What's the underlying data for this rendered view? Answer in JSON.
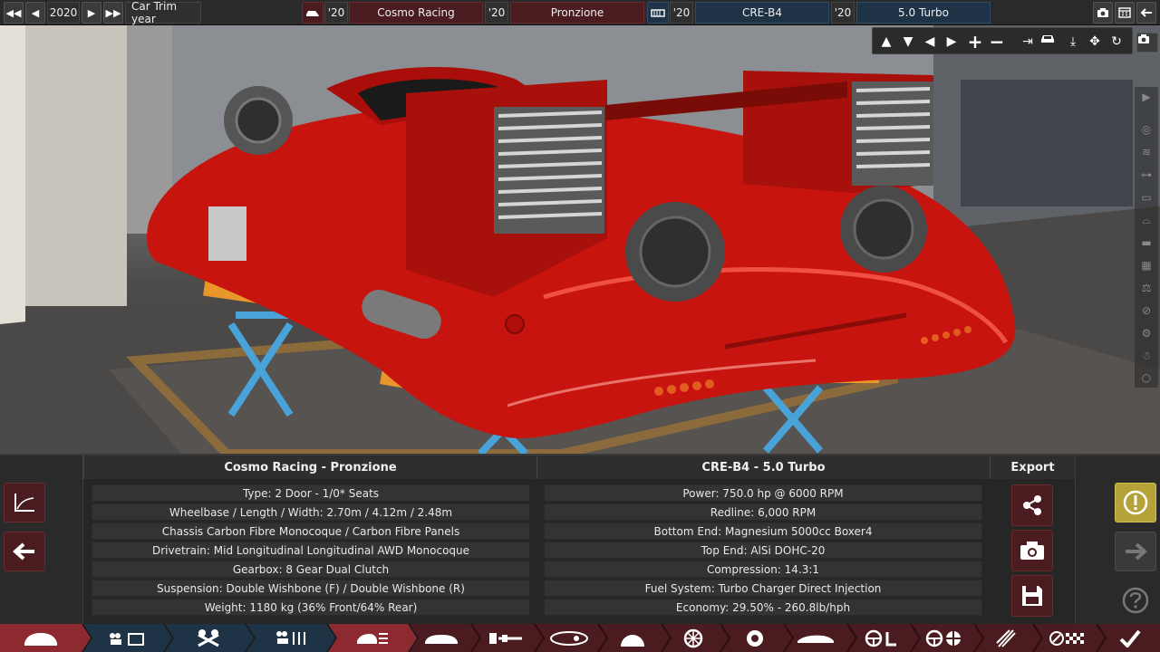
{
  "topbar": {
    "year": "2020",
    "trim_year_label": "Car Trim year",
    "model_year": "'20",
    "model_name": "Cosmo Racing",
    "trim_year": "'20",
    "trim_name": "Pronzione",
    "engine_family_year": "'20",
    "engine_family": "CRE-B4",
    "engine_variant_year": "'20",
    "engine_variant": "5.0 Turbo"
  },
  "car_panel": {
    "title": "Cosmo Racing - Pronzione",
    "rows": [
      "Type: 2 Door - 1/0* Seats",
      "Wheelbase / Length / Width: 2.70m / 4.12m / 2.48m",
      "Chassis Carbon Fibre Monocoque / Carbon Fibre Panels",
      "Drivetrain: Mid Longitudinal Longitudinal AWD Monocoque",
      "Gearbox: 8 Gear Dual Clutch",
      "Suspension: Double Wishbone (F) / Double Wishbone (R)",
      "Weight: 1180 kg (36% Front/64% Rear)"
    ]
  },
  "engine_panel": {
    "title": "CRE-B4 - 5.0 Turbo",
    "rows": [
      "Power: 750.0 hp @ 6000 RPM",
      "Redline:  6,000 RPM",
      "Bottom End: Magnesium 5000cc Boxer4",
      "Top End: AlSi DOHC-20",
      "Compression: 14.3:1",
      "Fuel System: Turbo Charger Direct Injection",
      "Economy: 29.50% - 260.8lb/hph"
    ]
  },
  "export": {
    "title": "Export"
  },
  "icons": {
    "graph": "graph-icon",
    "back": "back-arrow-icon",
    "share": "share-icon",
    "camera": "camera-icon",
    "save": "floppy-icon",
    "warning": "warning-icon",
    "next": "next-arrow-icon",
    "help": "help-icon"
  },
  "colors": {
    "accent_red": "#4a1c1f",
    "accent_blue": "#1f3346",
    "warning_gold": "#b5a238",
    "car_body": "#c8140e"
  }
}
